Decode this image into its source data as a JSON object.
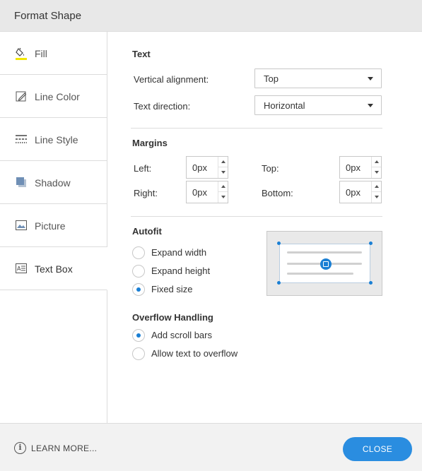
{
  "window": {
    "title": "Format Shape"
  },
  "sidebar": {
    "items": [
      {
        "label": "Fill",
        "icon": "paint-bucket-icon"
      },
      {
        "label": "Line Color",
        "icon": "pencil-icon"
      },
      {
        "label": "Line Style",
        "icon": "line-style-icon"
      },
      {
        "label": "Shadow",
        "icon": "shadow-icon"
      },
      {
        "label": "Picture",
        "icon": "picture-icon"
      },
      {
        "label": "Text Box",
        "icon": "text-box-icon"
      }
    ],
    "active": "Text Box"
  },
  "text_section": {
    "title": "Text",
    "vertical_alignment": {
      "label": "Vertical alignment:",
      "value": "Top"
    },
    "text_direction": {
      "label": "Text direction:",
      "value": "Horizontal"
    }
  },
  "margins": {
    "title": "Margins",
    "left": {
      "label": "Left:",
      "value": "0px"
    },
    "top": {
      "label": "Top:",
      "value": "0px"
    },
    "right": {
      "label": "Right:",
      "value": "0px"
    },
    "bottom": {
      "label": "Bottom:",
      "value": "0px"
    }
  },
  "autofit": {
    "title": "Autofit",
    "options": [
      {
        "label": "Expand width",
        "checked": false
      },
      {
        "label": "Expand height",
        "checked": false
      },
      {
        "label": "Fixed size",
        "checked": true
      }
    ]
  },
  "overflow": {
    "title": "Overflow Handling",
    "options": [
      {
        "label": "Add scroll bars",
        "checked": true
      },
      {
        "label": "Allow text to overflow",
        "checked": false
      }
    ]
  },
  "footer": {
    "learn_more": "LEARN MORE...",
    "close": "CLOSE"
  },
  "colors": {
    "accent": "#2a8de0",
    "fill_underline": "#f2e600"
  }
}
